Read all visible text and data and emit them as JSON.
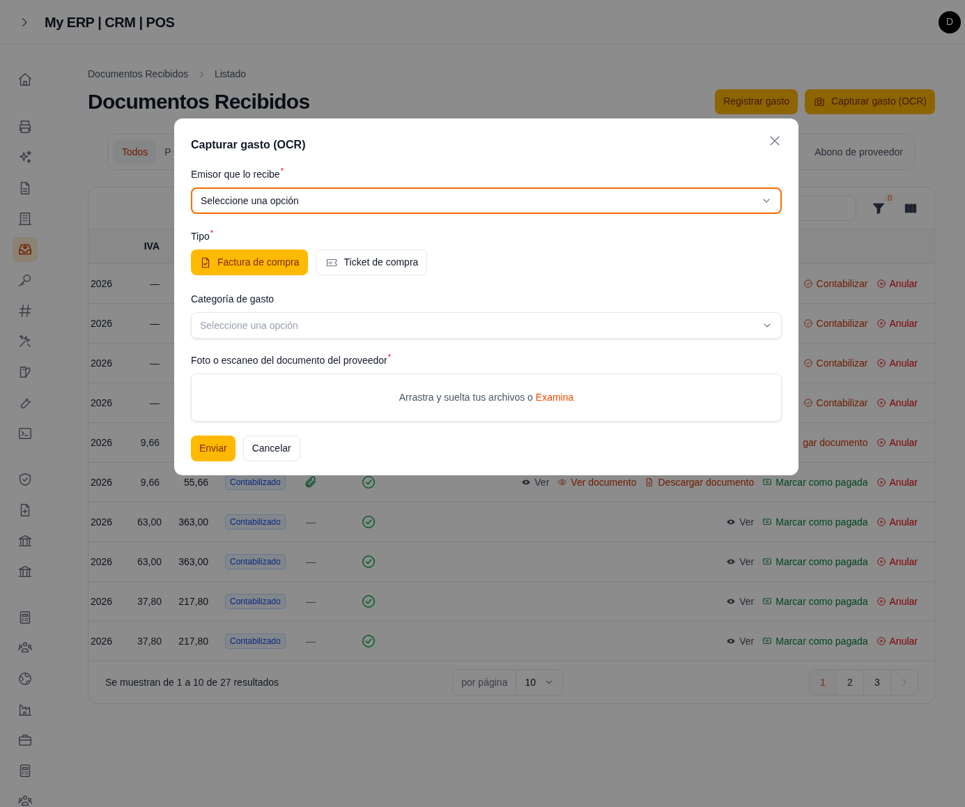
{
  "header": {
    "title": "My ERP | CRM | POS",
    "avatar": "D"
  },
  "sidebar": {
    "groups": [
      [
        {
          "selected": false
        }
      ],
      [
        {
          "selected": false
        },
        {
          "selected": false
        },
        {
          "selected": false
        },
        {
          "selected": false
        },
        {
          "selected": true
        },
        {
          "selected": false
        },
        {
          "selected": false
        },
        {
          "selected": false
        },
        {
          "selected": false
        },
        {
          "selected": false
        },
        {
          "selected": false
        }
      ],
      [
        {
          "selected": false
        },
        {
          "selected": false
        },
        {
          "selected": false
        },
        {
          "selected": false
        }
      ],
      [
        {
          "selected": false
        },
        {
          "selected": false
        },
        {
          "selected": false
        },
        {
          "selected": false
        },
        {
          "selected": false
        },
        {
          "selected": false
        },
        {
          "selected": false
        }
      ]
    ]
  },
  "breadcrumb": [
    "Documentos Recibidos",
    "Listado"
  ],
  "title": "Documentos Recibidos",
  "actions": [
    {
      "kind": "plain",
      "label": "Registrar gasto"
    },
    {
      "kind": "camera",
      "label": "Capturar gasto (OCR)"
    }
  ],
  "tabs": [
    {
      "label": "Todos",
      "selected": true
    },
    {
      "label": "P",
      "selected": false
    },
    {
      "label": "Abono de proveedor",
      "selected": false
    }
  ],
  "toolbar": {
    "filter_count": "0"
  },
  "table": {
    "columns": [
      {
        "label": "IVA"
      }
    ],
    "rows": [
      {
        "date": "2026",
        "iva": "—",
        "actions": [
          {
            "kind": "post",
            "label": "Contabilizar"
          },
          {
            "kind": "cancel",
            "label": "Anular"
          }
        ]
      },
      {
        "date": "2026",
        "iva": "—",
        "actions": [
          {
            "kind": "post",
            "label": "Contabilizar"
          },
          {
            "kind": "cancel",
            "label": "Anular"
          }
        ]
      },
      {
        "date": "2026",
        "iva": "—",
        "actions": [
          {
            "kind": "post",
            "label": "Contabilizar"
          },
          {
            "kind": "cancel",
            "label": "Anular"
          }
        ]
      },
      {
        "date": "2026",
        "iva": "—",
        "actions": [
          {
            "kind": "post",
            "label": "Contabilizar"
          },
          {
            "kind": "cancel",
            "label": "Anular"
          }
        ]
      },
      {
        "date": "2026",
        "iva": "9,66",
        "actions": [
          {
            "kind": "download_partial",
            "label": "gar documento"
          },
          {
            "kind": "cancel",
            "label": "Anular"
          }
        ]
      },
      {
        "date": "2026",
        "iva": "9,66",
        "total": "55,66",
        "status": "Contabilizado",
        "attachment": {
          "kind": "icon"
        },
        "verified": true,
        "actions": [
          {
            "kind": "view",
            "label": "Ver"
          },
          {
            "kind": "view_doc",
            "label": "Ver documento"
          },
          {
            "kind": "download",
            "label": "Descargar documento"
          },
          {
            "kind": "pay",
            "label": "Marcar como pagada"
          },
          {
            "kind": "cancel",
            "label": "Anular"
          }
        ]
      },
      {
        "date": "2026",
        "iva": "63,00",
        "total": "363,00",
        "status": "Contabilizado",
        "attachment": {
          "kind": "text",
          "text": "—"
        },
        "verified": true,
        "actions": [
          {
            "kind": "view",
            "label": "Ver"
          },
          {
            "kind": "pay",
            "label": "Marcar como pagada"
          },
          {
            "kind": "cancel",
            "label": "Anular"
          }
        ]
      },
      {
        "date": "2026",
        "iva": "63,00",
        "total": "363,00",
        "status": "Contabilizado",
        "attachment": {
          "kind": "text",
          "text": "—"
        },
        "verified": true,
        "actions": [
          {
            "kind": "view",
            "label": "Ver"
          },
          {
            "kind": "pay",
            "label": "Marcar como pagada"
          },
          {
            "kind": "cancel",
            "label": "Anular"
          }
        ]
      },
      {
        "date": "2026",
        "iva": "37,80",
        "total": "217,80",
        "status": "Contabilizado",
        "attachment": {
          "kind": "text",
          "text": "—"
        },
        "verified": true,
        "actions": [
          {
            "kind": "view",
            "label": "Ver"
          },
          {
            "kind": "pay",
            "label": "Marcar como pagada"
          },
          {
            "kind": "cancel",
            "label": "Anular"
          }
        ]
      },
      {
        "date": "2026",
        "iva": "37,80",
        "total": "217,80",
        "status": "Contabilizado",
        "attachment": {
          "kind": "text",
          "text": "—"
        },
        "verified": true,
        "actions": [
          {
            "kind": "view",
            "label": "Ver"
          },
          {
            "kind": "pay",
            "label": "Marcar como pagada"
          },
          {
            "kind": "cancel",
            "label": "Anular"
          }
        ]
      }
    ]
  },
  "footer": {
    "summary": "Se muestran de 1 a 10 de 27 resultados",
    "per_page_label": "por página",
    "per_page": "10",
    "pages": [
      {
        "label": "1",
        "selected": true
      },
      {
        "label": "2",
        "selected": false
      },
      {
        "label": "3",
        "selected": false
      }
    ]
  },
  "modal": {
    "title": "Capturar gasto (OCR)",
    "fields": [
      {
        "kind": "select",
        "label": "Emisor que lo recibe",
        "required_mark": "*",
        "value": "Seleccione una opción",
        "focused": true
      },
      {
        "kind": "choice",
        "label": "Tipo",
        "required_mark": "*",
        "options": [
          {
            "kind": "invoice",
            "label": "Factura de compra",
            "selected": true
          },
          {
            "kind": "ticket",
            "label": "Ticket de compra",
            "selected": false
          }
        ]
      },
      {
        "kind": "select",
        "label": "Categoría de gasto",
        "placeholder": "Seleccione una opción",
        "focused": false
      },
      {
        "kind": "dropzone",
        "label": "Foto o escaneo del documento del proveedor",
        "required_mark": "*",
        "text": "Arrastra y suelta tus archivos o",
        "link": "Examina"
      }
    ],
    "buttons": [
      {
        "kind": "primary",
        "label": "Enviar"
      },
      {
        "kind": "secondary",
        "label": "Cancelar"
      }
    ]
  }
}
